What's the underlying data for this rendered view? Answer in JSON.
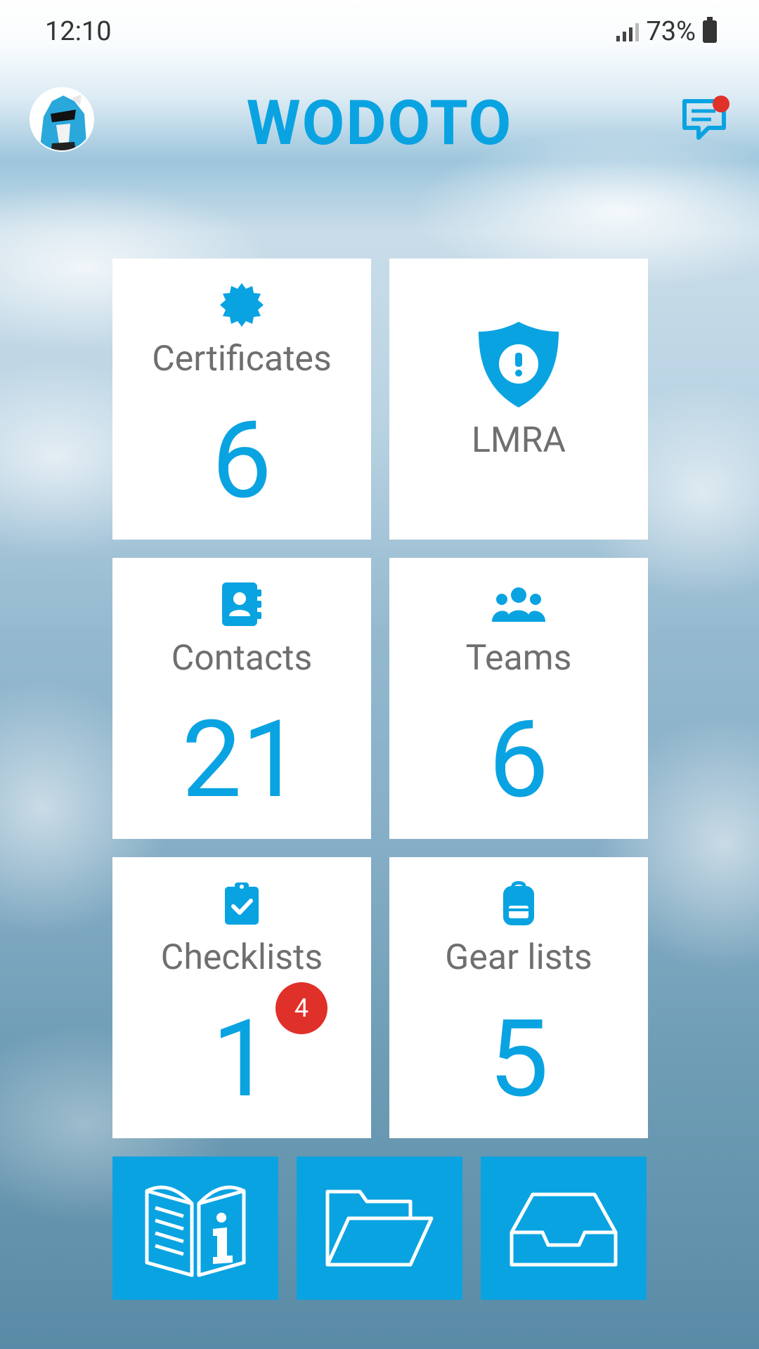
{
  "status_bar": {
    "time": "12:10",
    "battery": "73%"
  },
  "header": {
    "title": "WODOTO"
  },
  "tiles": [
    {
      "label": "Certificates",
      "count": "6",
      "icon": "certificate-badge-icon"
    },
    {
      "label": "LMRA",
      "icon": "shield-alert-icon"
    },
    {
      "label": "Contacts",
      "count": "21",
      "icon": "address-book-icon"
    },
    {
      "label": "Teams",
      "count": "6",
      "icon": "team-icon"
    },
    {
      "label": "Checklists",
      "count": "1",
      "badge": "4",
      "icon": "clipboard-check-icon"
    },
    {
      "label": "Gear lists",
      "count": "5",
      "icon": "backpack-icon"
    }
  ],
  "bottom_buttons": [
    {
      "icon": "info-book-icon"
    },
    {
      "icon": "folder-open-icon"
    },
    {
      "icon": "inbox-tray-icon"
    }
  ],
  "colors": {
    "accent": "#0aa3e1",
    "badge": "#e0302a",
    "label": "#6f6f6f"
  }
}
